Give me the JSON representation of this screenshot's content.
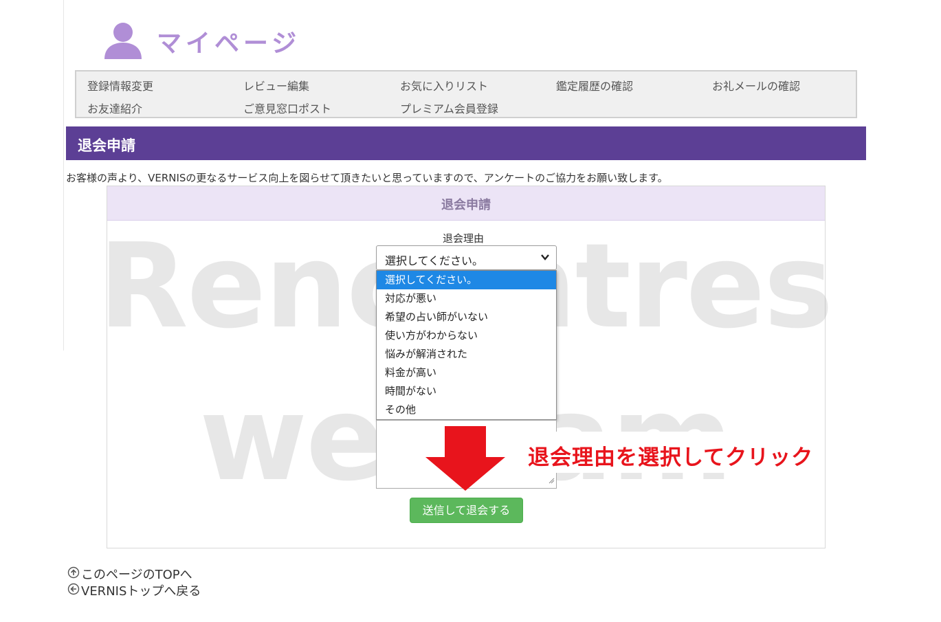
{
  "header": {
    "title": "マイページ",
    "icon": "user-icon"
  },
  "nav": {
    "items": [
      "登録情報変更",
      "レビュー編集",
      "お気に入りリスト",
      "鑑定履歴の確認",
      "お礼メールの確認",
      "お友達紹介",
      "ご意見窓口ポスト",
      "プレミアム会員登録"
    ]
  },
  "section": {
    "title": "退会申請"
  },
  "intro": "お客様の声より、VERNISの更なるサービス向上を図らせて頂きたいと思っていますので、アンケートのご協力をお願い致します。",
  "form": {
    "panel_title": "退会申請",
    "reason_label": "退会理由",
    "select_value": "選択してください。",
    "options": [
      "選択してください。",
      "対応が悪い",
      "希望の占い師がいない",
      "使い方がわからない",
      "悩みが解消された",
      "料金が高い",
      "時間がない",
      "その他"
    ],
    "submit_label": "送信して退会する"
  },
  "annotation": "退会理由を選択してクリック",
  "watermark": {
    "line1": "Rencontres",
    "line2": "webcam"
  },
  "footer": {
    "top_link": "このページのTOPへ",
    "back_link": "VERNISトップへ戻る"
  },
  "colors": {
    "section_bar": "#5c3f95",
    "accent_purple": "#b08ed6",
    "submit_green": "#5cb85c",
    "annotation_red": "#e8141c",
    "option_selected": "#1e88e5"
  }
}
